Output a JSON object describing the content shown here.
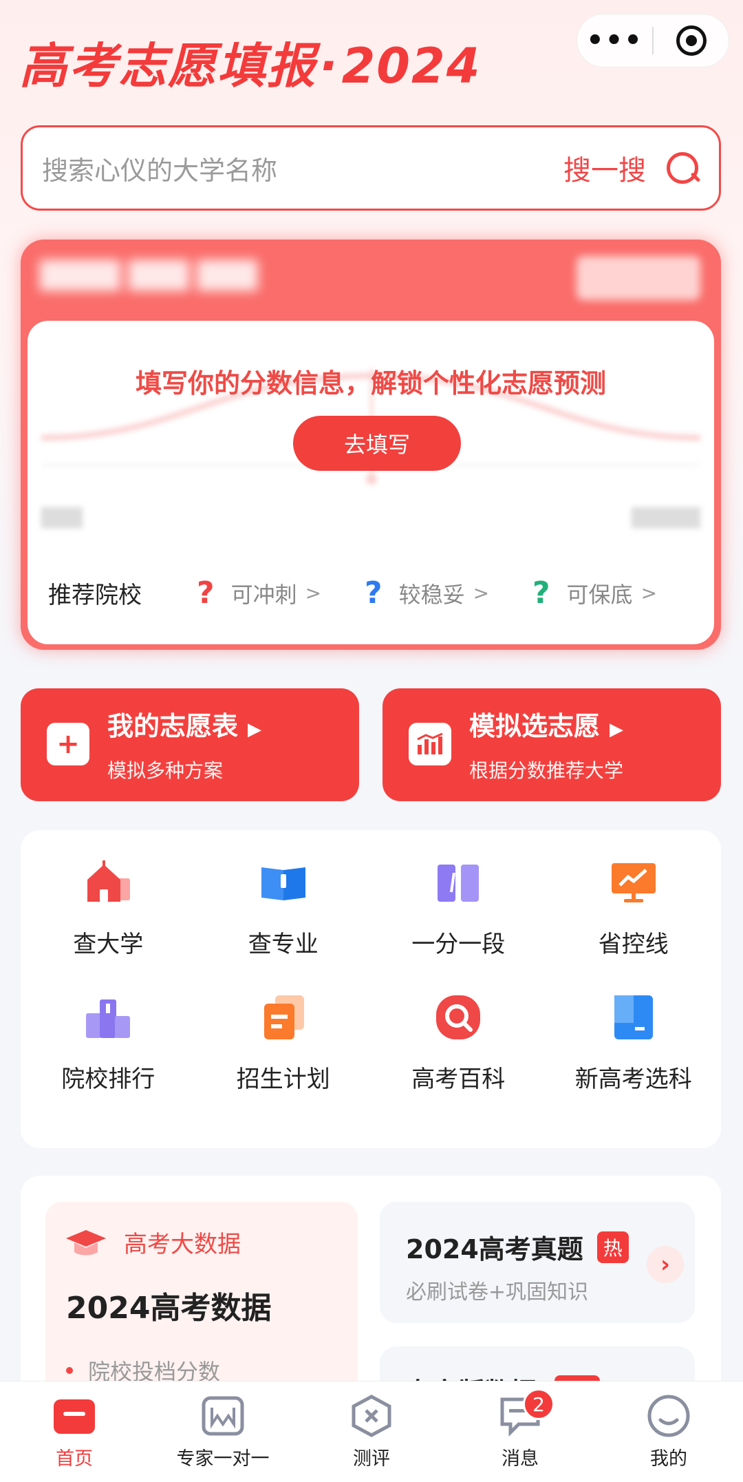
{
  "header": {
    "brand_text": "高考志愿填报",
    "brand_dot": "·",
    "brand_year": "2024",
    "capsule_more": "•••"
  },
  "search": {
    "placeholder": "搜索心仪的大学名称",
    "button": "搜一搜"
  },
  "prediction": {
    "headline": "填写你的分数信息，解锁个性化志愿预测",
    "fill_button": "去填写",
    "recommend_label": "推荐院校",
    "options": [
      {
        "q": "?",
        "label": "可冲刺",
        "color": "#f04444"
      },
      {
        "q": "?",
        "label": "较稳妥",
        "color": "#2f7af0"
      },
      {
        "q": "?",
        "label": "可保底",
        "color": "#21b07a"
      }
    ]
  },
  "quick": [
    {
      "title": "我的志愿表",
      "sub": "模拟多种方案",
      "icon": "plus-doc-icon"
    },
    {
      "title": "模拟选志愿",
      "sub": "根据分数推荐大学",
      "icon": "chart-icon"
    }
  ],
  "functions": [
    {
      "label": "查大学",
      "icon": "school-icon"
    },
    {
      "label": "查专业",
      "icon": "book-icon"
    },
    {
      "label": "一分一段",
      "icon": "segment-icon"
    },
    {
      "label": "省控线",
      "icon": "monitor-icon"
    },
    {
      "label": "院校排行",
      "icon": "podium-icon"
    },
    {
      "label": "招生计划",
      "icon": "plan-icon"
    },
    {
      "label": "高考百科",
      "icon": "search-icon"
    },
    {
      "label": "新高考选科",
      "icon": "bookmark-icon"
    }
  ],
  "bigdata": {
    "tag": "高考大数据",
    "title": "2024高考数据",
    "item": "院校投档分数"
  },
  "real": {
    "title": "2024高考真题",
    "hot": "热",
    "sub": "必刷试卷+巩固知识"
  },
  "cut_card": {
    "title": "专家版数据"
  },
  "tabs": [
    {
      "label": "首页",
      "icon": "home-icon"
    },
    {
      "label": "专家一对一",
      "icon": "expert-icon"
    },
    {
      "label": "测评",
      "icon": "assessment-icon"
    },
    {
      "label": "消息",
      "icon": "message-icon",
      "badge": "2"
    },
    {
      "label": "我的",
      "icon": "profile-icon"
    }
  ],
  "colors": {
    "accent": "#f33b3b",
    "page_bg": "#f5f6fa"
  }
}
